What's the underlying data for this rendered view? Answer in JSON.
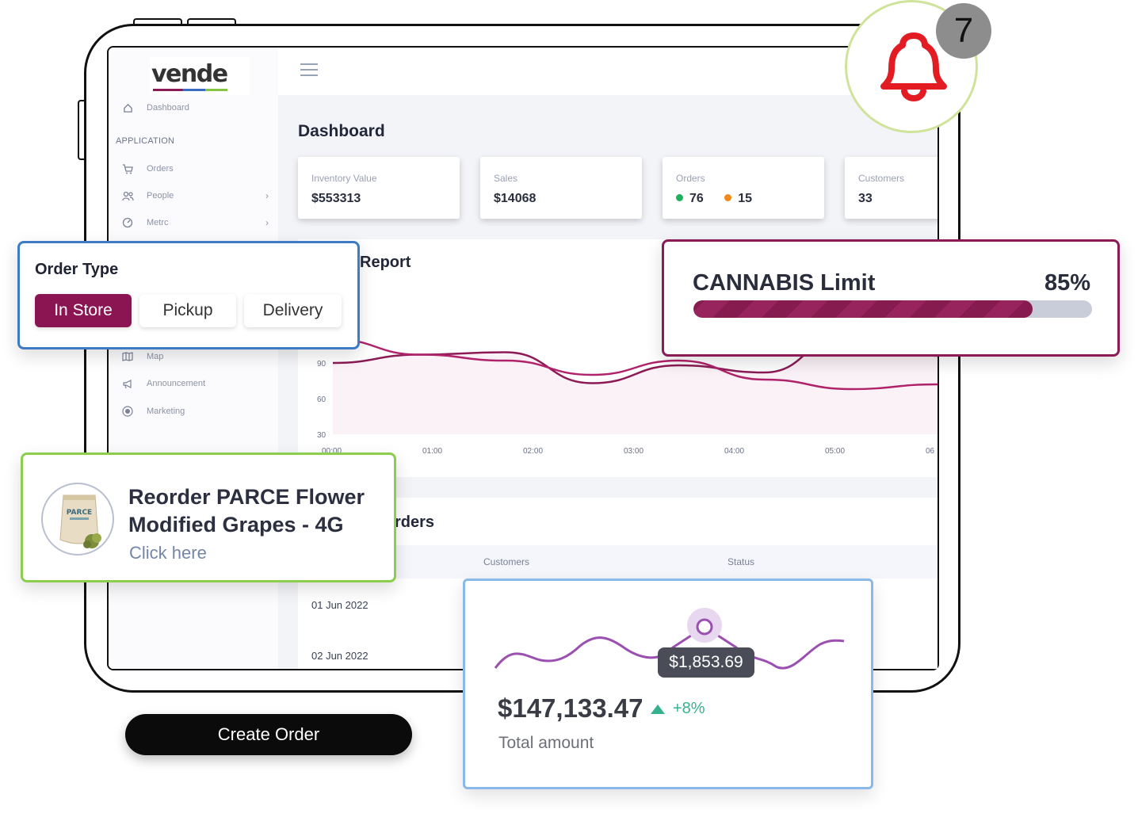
{
  "sidebar": {
    "logo": "vende",
    "dashboard": "Dashboard",
    "section": "APPLICATION",
    "items": [
      {
        "label": "Orders",
        "icon": "cart-icon"
      },
      {
        "label": "People",
        "icon": "people-icon"
      },
      {
        "label": "Metrc",
        "icon": "gauge-icon"
      },
      {
        "label": "Map",
        "icon": "map-icon"
      },
      {
        "label": "Announcement",
        "icon": "megaphone-icon"
      },
      {
        "label": "Marketing",
        "icon": "target-icon"
      }
    ]
  },
  "main": {
    "title": "Dashboard",
    "stats": [
      {
        "label": "Inventory Value",
        "value": "$553313"
      },
      {
        "label": "Sales",
        "value": "$14068"
      },
      {
        "label": "Orders",
        "green": "76",
        "orange": "15"
      },
      {
        "label": "Customers",
        "value": "33"
      }
    ],
    "report_title": "Report",
    "recent_orders_title": "rders",
    "table": {
      "headers": [
        "Customers",
        "Status"
      ],
      "rows": [
        "01 Jun 2022",
        "02 Jun 2022"
      ]
    }
  },
  "chart_data": {
    "type": "line",
    "title": "Report",
    "x": [
      "00:00",
      "01:00",
      "02:00",
      "03:00",
      "04:00",
      "05:00",
      "06"
    ],
    "yticks": [
      30,
      60,
      90
    ],
    "series": [
      {
        "values": [
          90,
          97,
          99,
          73,
          88,
          82,
          118,
          96
        ]
      },
      {
        "values": [
          110,
          97,
          92,
          80,
          92,
          76,
          68,
          72
        ]
      }
    ],
    "colors": [
      "#8b1a55",
      "#b0226a"
    ]
  },
  "order_type": {
    "title": "Order Type",
    "options": [
      "In Store",
      "Pickup",
      "Delivery"
    ],
    "selected": "In Store"
  },
  "cannabis_limit": {
    "label": "CANNABIS Limit",
    "percent_text": "85%",
    "fraction": 0.85
  },
  "reorder": {
    "line1": "Reorder PARCE Flower",
    "line2": "Modified Grapes - 4G",
    "link": "Click here",
    "package_brand": "PARCE"
  },
  "amount_card": {
    "tooltip": "$1,853.69",
    "value": "$147,133.47",
    "change": "+8%",
    "label": "Total amount"
  },
  "notifications": {
    "count": "7",
    "icon": "bell-icon",
    "bell_color": "#e31b23"
  },
  "cta": {
    "label": "Create Order"
  },
  "colors": {
    "brand": "#8b1553",
    "accent_blue": "#3d7bc4",
    "accent_green": "#8ccd4e",
    "success": "#35b28d"
  }
}
